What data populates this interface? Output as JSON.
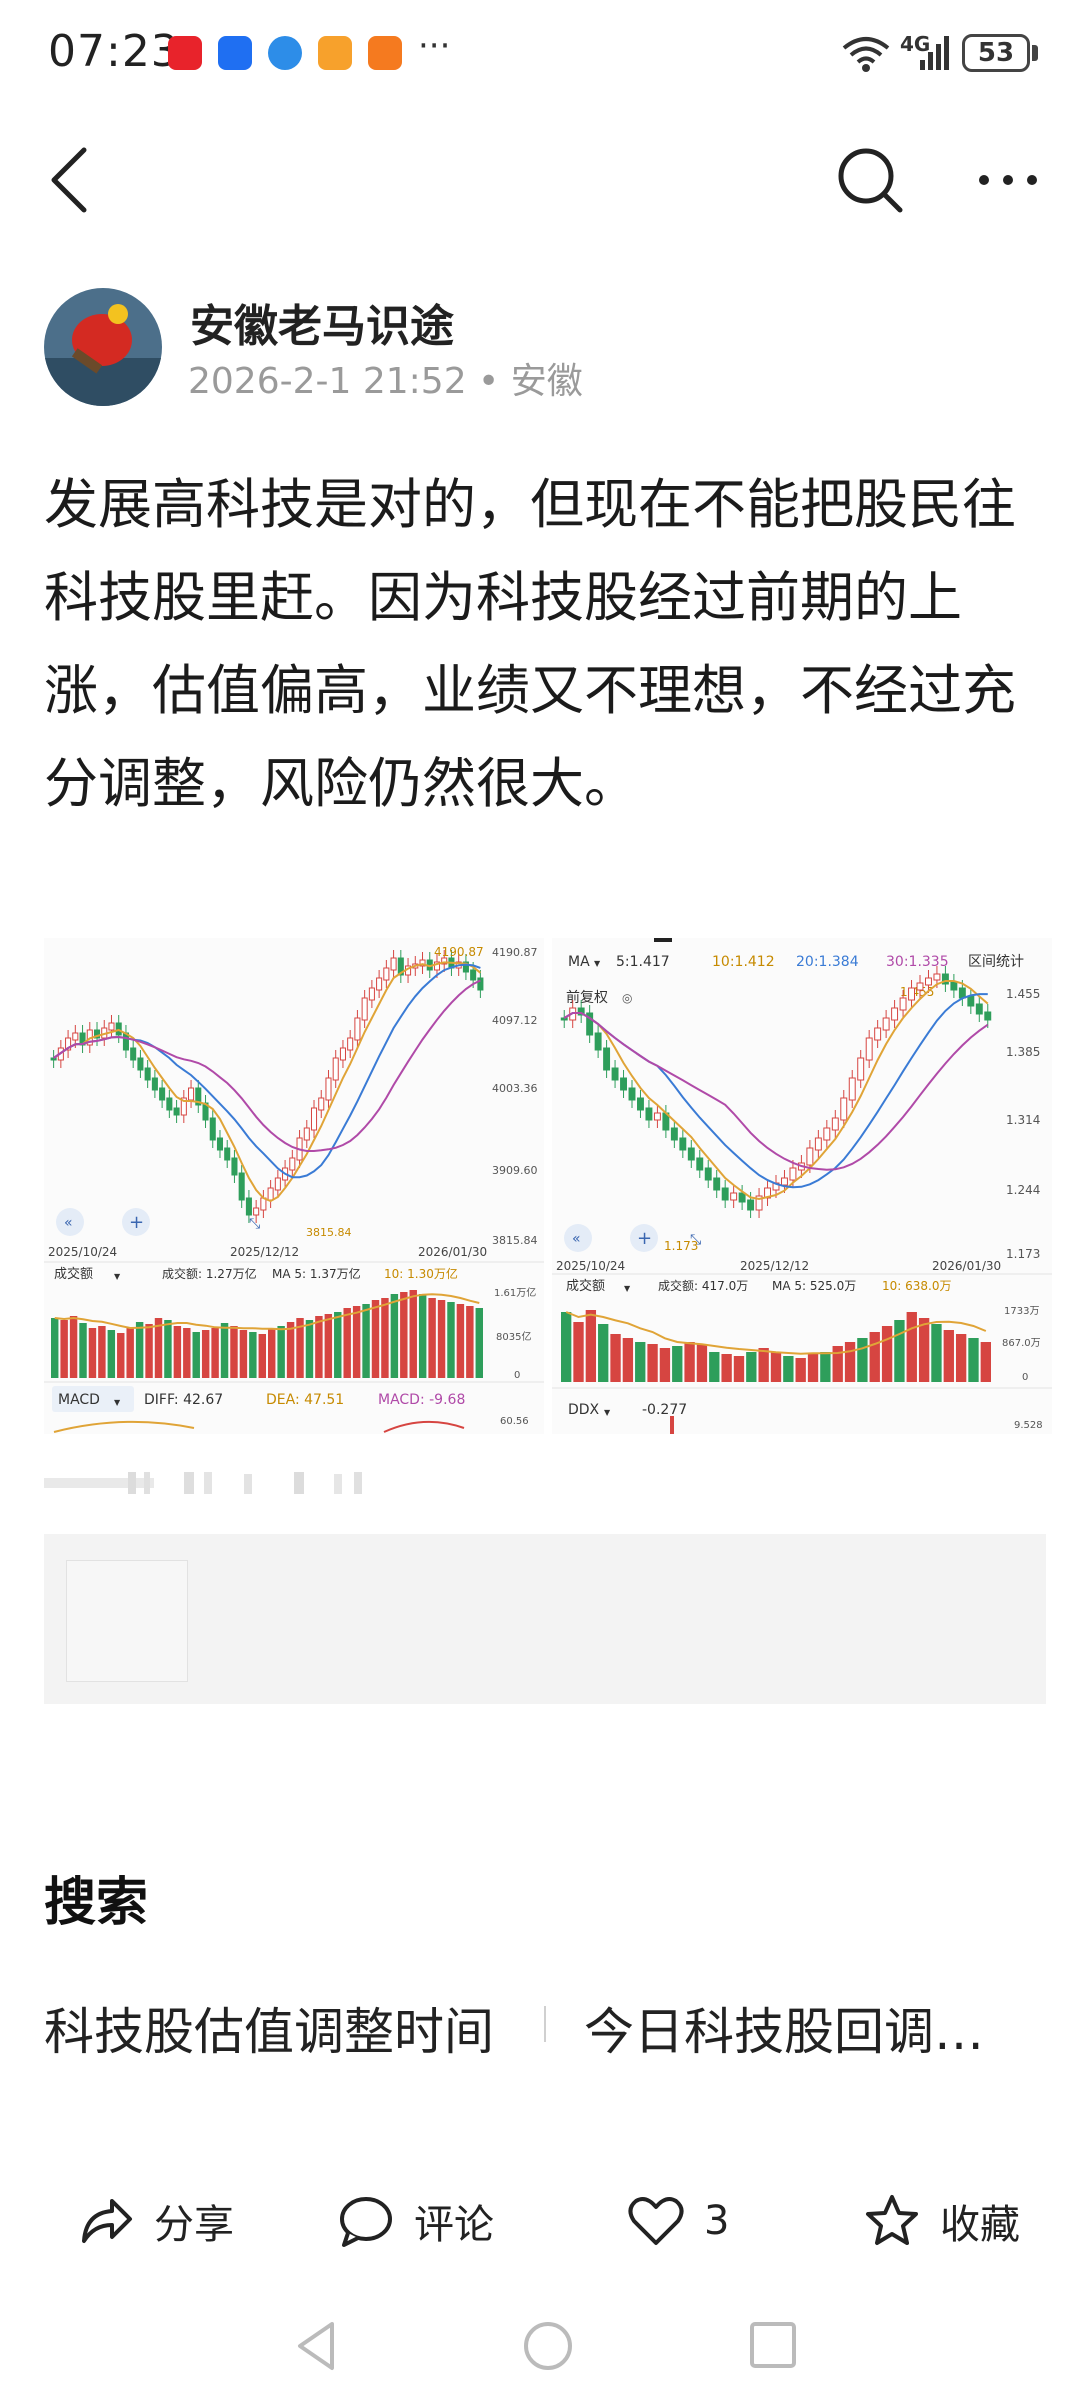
{
  "status_bar": {
    "time": "07:23",
    "more": "···",
    "network": "4G",
    "battery": "53",
    "app_icons": [
      "#e8232b",
      "#1f6ff2",
      "#2d8de8",
      "#f7a12c",
      "#f57a1f"
    ]
  },
  "nav": {
    "back_icon": "chevron-left-icon",
    "search_icon": "search-icon",
    "more_icon": "more-dots-icon"
  },
  "author": {
    "name": "安徽老马识途",
    "meta": "2026-2-1 21:52 • 安徽"
  },
  "post": {
    "text": "发展高科技是对的，但现在不能把股民往科技股里赶。因为科技股经过前期的上涨，估值偏高，业绩又不理想，不经过充分调整，风险仍然很大。"
  },
  "chart_left": {
    "high_label": "4190.87",
    "y_ticks": [
      "4190.87",
      "4097.12",
      "4003.36",
      "3909.60",
      "3815.84"
    ],
    "low_label": "3815.84",
    "date_start": "2025/10/24",
    "date_mid": "2025/12/12",
    "date_end": "2026/01/30",
    "vol_title": "成交额",
    "vol_value": "成交额: 1.27万亿",
    "vol_ma5": "MA 5: 1.37万亿",
    "vol_ma10": "10: 1.30万亿",
    "vol_ticks": [
      "1.61万亿",
      "8035亿",
      "0"
    ],
    "macd_title": "MACD",
    "diff": "DIFF: 42.67",
    "dea": "DEA: 47.51",
    "macd": "MACD: -9.68",
    "macd_tick": "60.56"
  },
  "chart_right": {
    "ma_title": "MA",
    "ma5": "5:1.417",
    "ma10": "10:1.412",
    "ma20": "20:1.384",
    "ma30": "30:1.335",
    "range_stats": "区间统计",
    "adjust": "前复权",
    "high_label": "1.455",
    "y_ticks": [
      "1.455",
      "1.385",
      "1.314",
      "1.244",
      "1.173"
    ],
    "low_label": "1.173",
    "date_start": "2025/10/24",
    "date_mid": "2025/12/12",
    "date_end": "2026/01/30",
    "vol_title": "成交额",
    "vol_value": "成交额: 417.0万",
    "vol_ma5": "MA 5: 525.0万",
    "vol_ma10": "10: 638.0万",
    "vol_ticks": [
      "1733万",
      "867.0万",
      "0"
    ],
    "ddx_title": "DDX",
    "ddx_value": "-0.277",
    "ddx_tick": "9.528"
  },
  "search": {
    "title": "搜索",
    "suggestions": [
      "科技股估值调整时间",
      "今日科技股回调…"
    ]
  },
  "actions": {
    "share": "分享",
    "comment": "评论",
    "like_count": "3",
    "favorite": "收藏"
  }
}
